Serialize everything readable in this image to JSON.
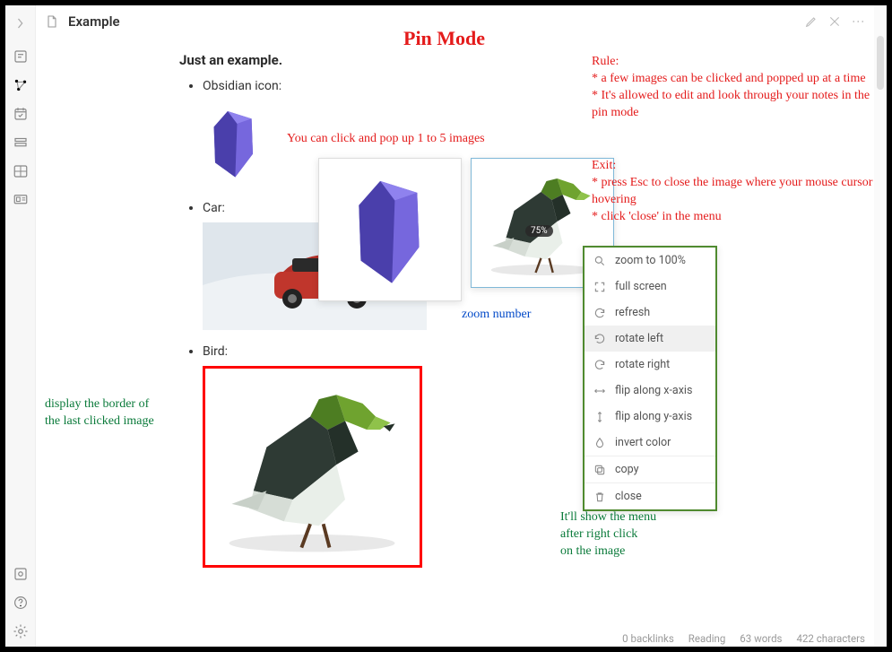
{
  "titlebar": {
    "title": "Example"
  },
  "document": {
    "heading": "Just an example.",
    "items": [
      {
        "label": "Obsidian icon:"
      },
      {
        "label": "Car:"
      },
      {
        "label": "Bird:"
      }
    ]
  },
  "popup_bird": {
    "zoom_label": "75%"
  },
  "context_menu": {
    "items": [
      {
        "key": "zoom100",
        "label": "zoom to 100%",
        "icon": "loupe"
      },
      {
        "key": "fullscr",
        "label": "full screen",
        "icon": "fullscreen"
      },
      {
        "key": "refresh",
        "label": "refresh",
        "icon": "refresh"
      },
      {
        "key": "rotleft",
        "label": "rotate left",
        "icon": "rot-left",
        "highlight": true
      },
      {
        "key": "rotright",
        "label": "rotate right",
        "icon": "rot-right"
      },
      {
        "key": "flipx",
        "label": "flip along x-axis",
        "icon": "arrows-h"
      },
      {
        "key": "flipy",
        "label": "flip along y-axis",
        "icon": "arrows-v"
      },
      {
        "key": "invert",
        "label": "invert color",
        "icon": "drop"
      },
      {
        "key": "copy",
        "label": "copy",
        "icon": "copy",
        "sep": true
      },
      {
        "key": "close",
        "label": "close",
        "icon": "trash",
        "sep": true
      }
    ]
  },
  "annotations": {
    "title": "Pin Mode",
    "click_tip": "You can click and pop up 1 to 5 images",
    "zoom_number": "zoom number",
    "border_tip_l1": "display the border of",
    "border_tip_l2": "the last clicked image",
    "rule_heading": "Rule:",
    "rule_1": "a few images can be clicked and popped up at a time",
    "rule_2": "It's allowed to edit and look through your notes in the pin mode",
    "exit_heading": "Exit:",
    "exit_1": "press Esc to close the image where your mouse cursor is hovering",
    "exit_2": "click 'close' in the menu",
    "menu_tip_l1": "It'll show the menu",
    "menu_tip_l2": "after right click",
    "menu_tip_l3": "on the image"
  },
  "statusbar": {
    "backlinks": "0 backlinks",
    "mode": "Reading",
    "words": "63 words",
    "chars": "422 characters"
  }
}
